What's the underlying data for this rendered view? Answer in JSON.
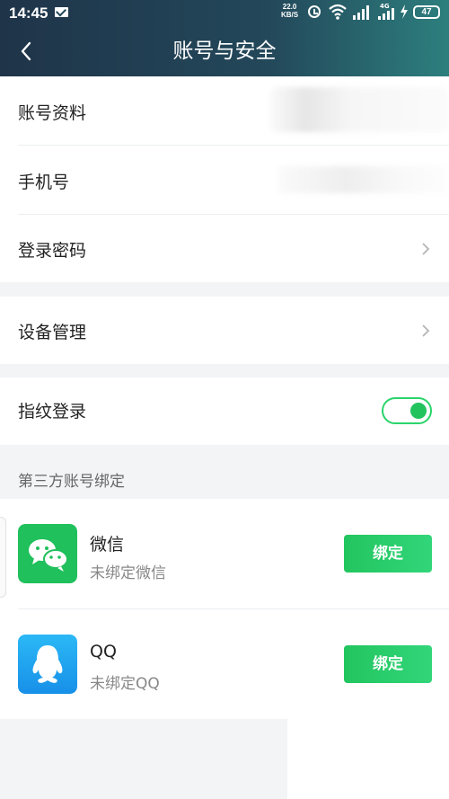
{
  "status_bar": {
    "time": "14:45",
    "net_speed_value": "22.0",
    "net_speed_unit": "KB/S",
    "network_type": "4G",
    "battery": "47",
    "icons": [
      "mail-icon",
      "alarm-icon",
      "wifi-icon",
      "signal-icon",
      "signal-icon",
      "charging-bolt-icon",
      "battery-icon"
    ]
  },
  "header": {
    "title": "账号与安全",
    "back_icon": "chevron-left-icon"
  },
  "account": {
    "profile_label": "账号资料",
    "phone_label": "手机号",
    "password_label": "登录密码"
  },
  "device": {
    "label": "设备管理"
  },
  "fingerprint": {
    "label": "指纹登录",
    "enabled": true,
    "accent": "#22c35d"
  },
  "third_party": {
    "section_title": "第三方账号绑定",
    "items": [
      {
        "name": "微信",
        "status": "未绑定微信",
        "button": "绑定",
        "icon": "wechat-icon",
        "color": "#20c05c"
      },
      {
        "name": "QQ",
        "status": "未绑定QQ",
        "button": "绑定",
        "icon": "qq-icon",
        "color": "#1aa1ee"
      }
    ]
  }
}
